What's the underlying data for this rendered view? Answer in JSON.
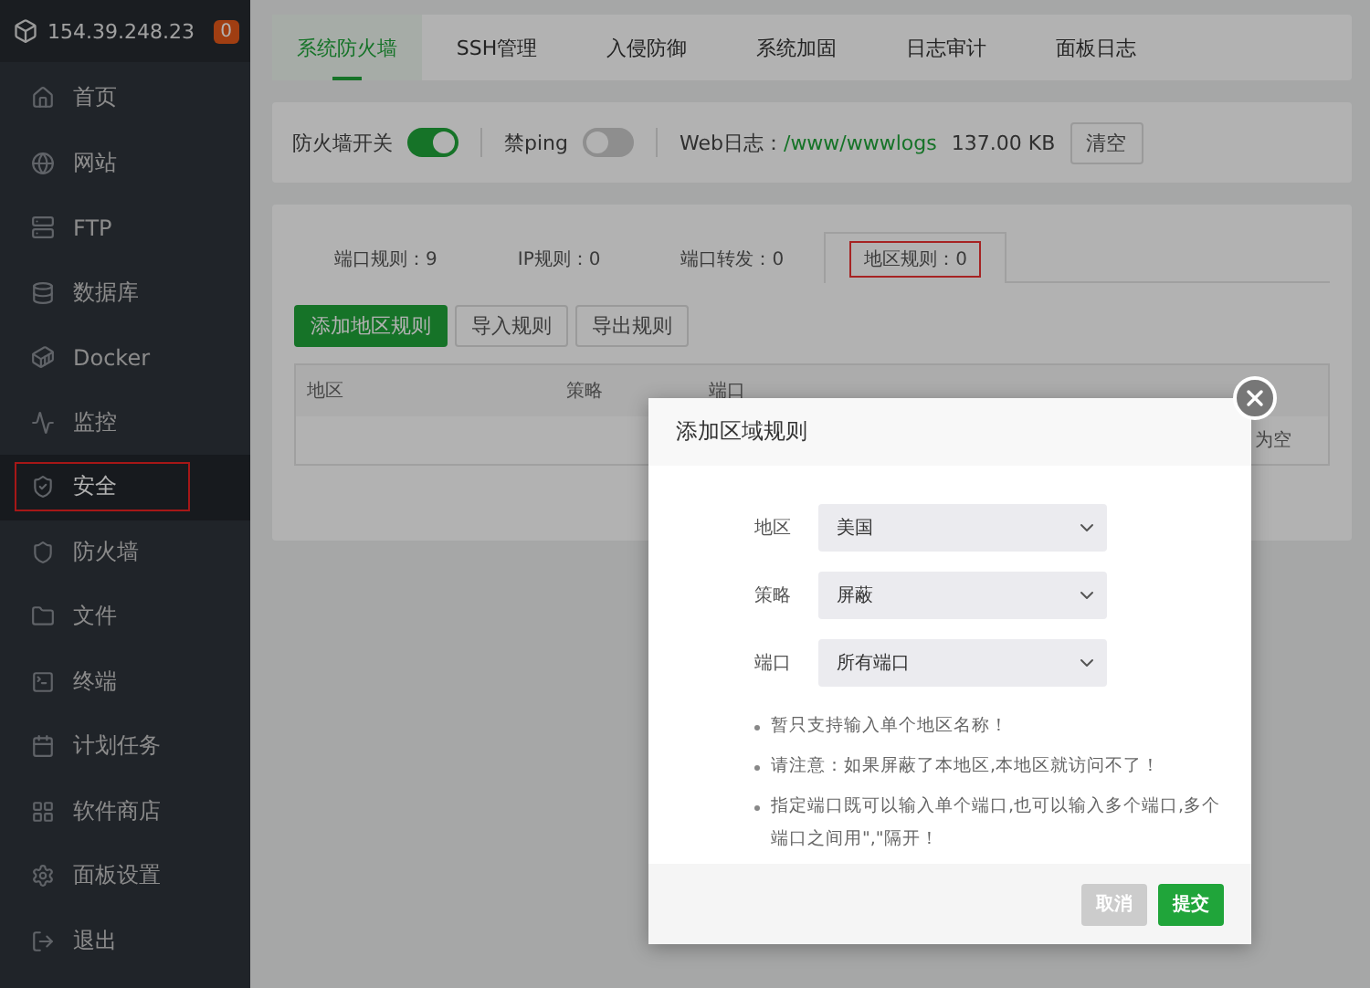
{
  "server": {
    "address": "154.39.248.23",
    "badge": "0"
  },
  "sidebar": {
    "items": [
      {
        "label": "首页",
        "selected": false
      },
      {
        "label": "网站",
        "selected": false
      },
      {
        "label": "FTP",
        "selected": false
      },
      {
        "label": "数据库",
        "selected": false
      },
      {
        "label": "Docker",
        "selected": false
      },
      {
        "label": "监控",
        "selected": false
      },
      {
        "label": "安全",
        "selected": true,
        "highlighted": true
      },
      {
        "label": "防火墙",
        "selected": false
      },
      {
        "label": "文件",
        "selected": false
      },
      {
        "label": "终端",
        "selected": false
      },
      {
        "label": "计划任务",
        "selected": false
      },
      {
        "label": "软件商店",
        "selected": false
      },
      {
        "label": "面板设置",
        "selected": false
      },
      {
        "label": "退出",
        "selected": false
      }
    ]
  },
  "tabs": [
    {
      "label": "系统防火墙",
      "selected": true
    },
    {
      "label": "SSH管理",
      "selected": false
    },
    {
      "label": "入侵防御",
      "selected": false
    },
    {
      "label": "系统加固",
      "selected": false
    },
    {
      "label": "日志审计",
      "selected": false
    },
    {
      "label": "面板日志",
      "selected": false
    }
  ],
  "settings": {
    "firewall": {
      "label": "防火墙开关",
      "on": true
    },
    "ping": {
      "label": "禁ping",
      "on": false
    },
    "log_label": "Web日志：",
    "log_path": "/www/wwwlogs",
    "log_size": "137.00 KB",
    "clear_button": "清空"
  },
  "rule_tabs": [
    {
      "label": "端口规则：9",
      "selected": false,
      "highlighted": false
    },
    {
      "label": "IP规则：0",
      "selected": false,
      "highlighted": false
    },
    {
      "label": "端口转发：0",
      "selected": false,
      "highlighted": false
    },
    {
      "label": "地区规则：0",
      "selected": true,
      "highlighted": true
    }
  ],
  "actions": [
    "添加地区规则",
    "导入规则",
    "导出规则"
  ],
  "table": {
    "columns": [
      "地区",
      "策略",
      "端口"
    ],
    "empty_text": "为空"
  },
  "dialog": {
    "title": "添加区域规则",
    "fields": [
      {
        "label": "地区",
        "value": "美国"
      },
      {
        "label": "策略",
        "value": "屏蔽"
      },
      {
        "label": "端口",
        "value": "所有端口"
      }
    ],
    "notes": [
      "暂只支持输入单个地区名称！",
      "请注意：如果屏蔽了本地区,本地区就访问不了！",
      "指定端口既可以输入单个端口,也可以输入多个端口,多个端口之间用\",\"隔开！"
    ],
    "cancel": "取消",
    "submit": "提交"
  }
}
